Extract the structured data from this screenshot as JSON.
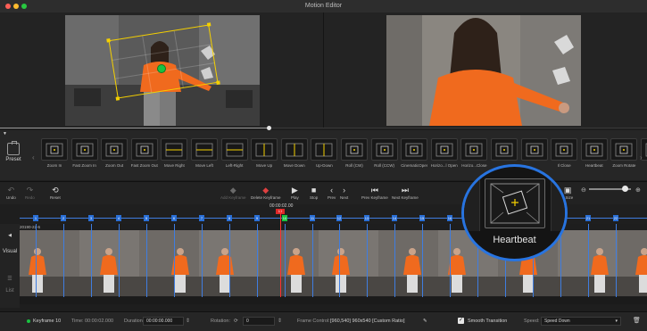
{
  "window": {
    "title": "Motion Editor"
  },
  "presets": {
    "label": "Preset",
    "effects": [
      "Zoom In",
      "Fast Zoom In",
      "Zoom Out",
      "Fast Zoom Out",
      "Move Right",
      "Move Left",
      "Left-Right",
      "Move Up",
      "Move Down",
      "Up-Down",
      "Roll (CW)",
      "Roll (CCW)",
      "CinematicOpen",
      "Horizo...l Open",
      "Horizo...Close",
      "",
      "",
      "Il Close",
      "Heartbeat",
      "Zoom Rotate",
      "Closeup"
    ]
  },
  "toolbar": {
    "undo": "Undo",
    "redo": "Redo",
    "reset": "Reset",
    "add_keyframe": "Add Keyframe",
    "delete_keyframe": "Delete Keyframe",
    "play": "Play",
    "stop": "Stop",
    "prev": "Prev",
    "next": "Next",
    "prev_keyframe": "Prev Keyframe",
    "next_keyframe": "Next Keyframe",
    "fit_size": "it Size"
  },
  "timeline": {
    "current_time": "00:00:02.00",
    "playhead_keyframe": "10",
    "track_label": "20190-22-6",
    "keyframes": [
      "1",
      "2",
      "3",
      "4",
      "5",
      "6",
      "7",
      "8",
      "9",
      "10",
      "11",
      "12",
      "13",
      "14",
      "15",
      "16",
      "17",
      "18",
      "19",
      "20",
      "21",
      "22"
    ]
  },
  "left_rail": {
    "visual": "Visual",
    "list": "List"
  },
  "magnifier": {
    "label": "Heartbeat"
  },
  "status": {
    "keyframe_label": "Keyframe 10",
    "time_label": "Time:",
    "time_value": "00:00:02.000",
    "duration_label": "Duration:",
    "duration_value": "00:00:00.000",
    "rotation_label": "Rotation:",
    "rotation_value": "0",
    "frame_control_label": "Frame Control:",
    "frame_control_value": "[960,540]  960x540  [Custom Ratio]",
    "smooth_label": "Smooth Transition",
    "smooth_checked": true,
    "speed_label": "Speed:",
    "speed_value": "Speed Down"
  },
  "progress": {
    "value": 0.415
  },
  "zoom": {
    "value": 0.85
  },
  "colors": {
    "accent": "#2874e0",
    "keyframe_active": "#19c241",
    "playhead": "#e02828",
    "crop": "#f5d000",
    "subject_shirt": "#f06a1e"
  }
}
